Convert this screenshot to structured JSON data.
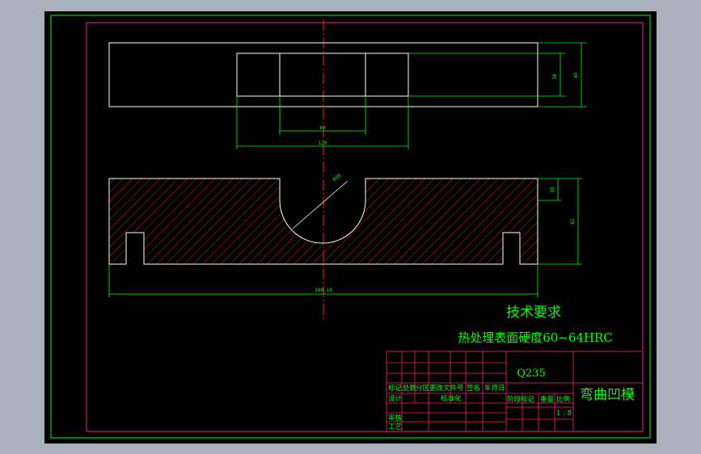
{
  "colors": {
    "background": "#a9b1bd",
    "paper": "#000000",
    "frame_outer": "#00ff00",
    "frame_inner": "#ff1e6e",
    "outline": "#ffffff",
    "hatch": "#c81e1e",
    "centerline": "#ff2020",
    "dimension": "#00ff00",
    "text": "#00ff00"
  },
  "dimensions": {
    "top_height_small": "30",
    "top_height_total": "45",
    "top_width_inner": "60",
    "top_width_outer": "120",
    "radius": "R30",
    "step_height": "15",
    "part_height": "61",
    "overall_length": "300.19"
  },
  "tech_requirements": {
    "title": "技术要求",
    "line1": "热处理表面硬度60~64HRC"
  },
  "title_block": {
    "material": "Q235",
    "part_name": "弯曲凹模",
    "header_row": [
      "标记",
      "处数",
      "分区",
      "更改文件号",
      "签名",
      "年月日"
    ],
    "design_label": "设计",
    "standardize_label": "标准化",
    "review_label": "审核",
    "process_label": "工艺",
    "stage_label": "阶段标记",
    "weight_label": "重量",
    "scale_label": "比例",
    "scale_value": "1 : 8"
  }
}
